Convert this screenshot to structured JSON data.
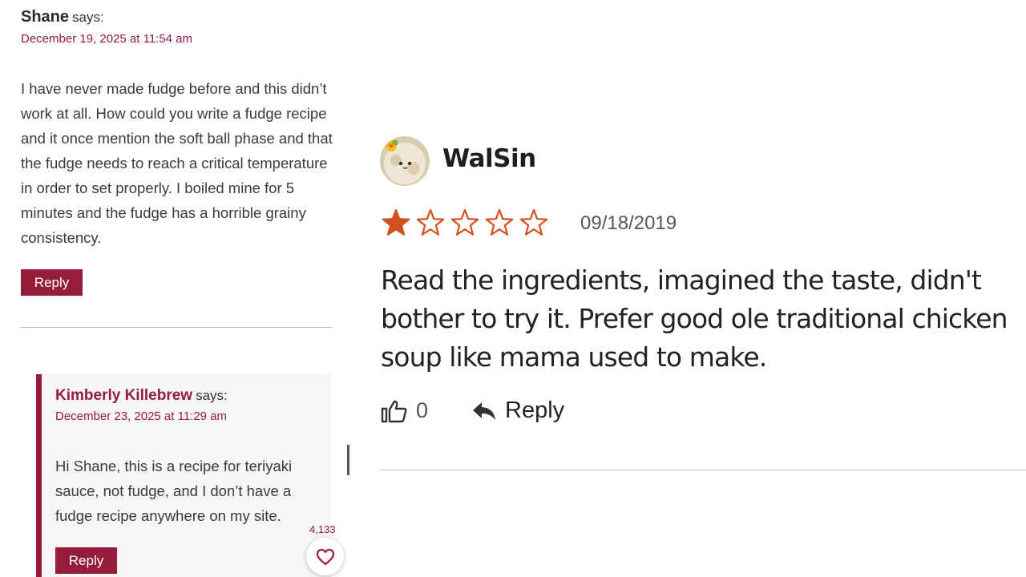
{
  "left_panel": {
    "comment": {
      "author": "Shane",
      "says": "says:",
      "date": "December 19, 2025 at 11:54 am",
      "body": "I have never made fudge before and this didn’t work at all. How could you write a fudge recipe and it once mention the soft ball phase and that the fudge needs to reach a critical temperature in order to set properly. I boiled mine for 5 minutes and the fudge has a horrible grainy consistency.",
      "reply_label": "Reply"
    },
    "nested_reply": {
      "author": "Kimberly Killebrew",
      "says": "says:",
      "date": "December 23, 2025 at 11:29 am",
      "body": "Hi Shane, this is a recipe for teriyaki sauce, not fudge, and I don’t have a fudge recipe anywhere on my site.",
      "reply_label": "Reply"
    },
    "like_count": "4,133",
    "heart_icon": "heart-outline-icon"
  },
  "right_panel": {
    "reviewer": "WalSin",
    "rating": 1,
    "max_rating": 5,
    "date": "09/18/2019",
    "body": "Read the ingredients, imagined the taste, didn't bother to try it. Prefer good ole traditional chicken soup like mama used to make.",
    "helpful_count": "0",
    "reply_label": "Reply",
    "icons": [
      "thumbs-up-icon",
      "reply-arrow-icon"
    ]
  },
  "colors": {
    "accent": "#951c3b",
    "star": "#d3501f",
    "text": "#3a3a3a"
  }
}
